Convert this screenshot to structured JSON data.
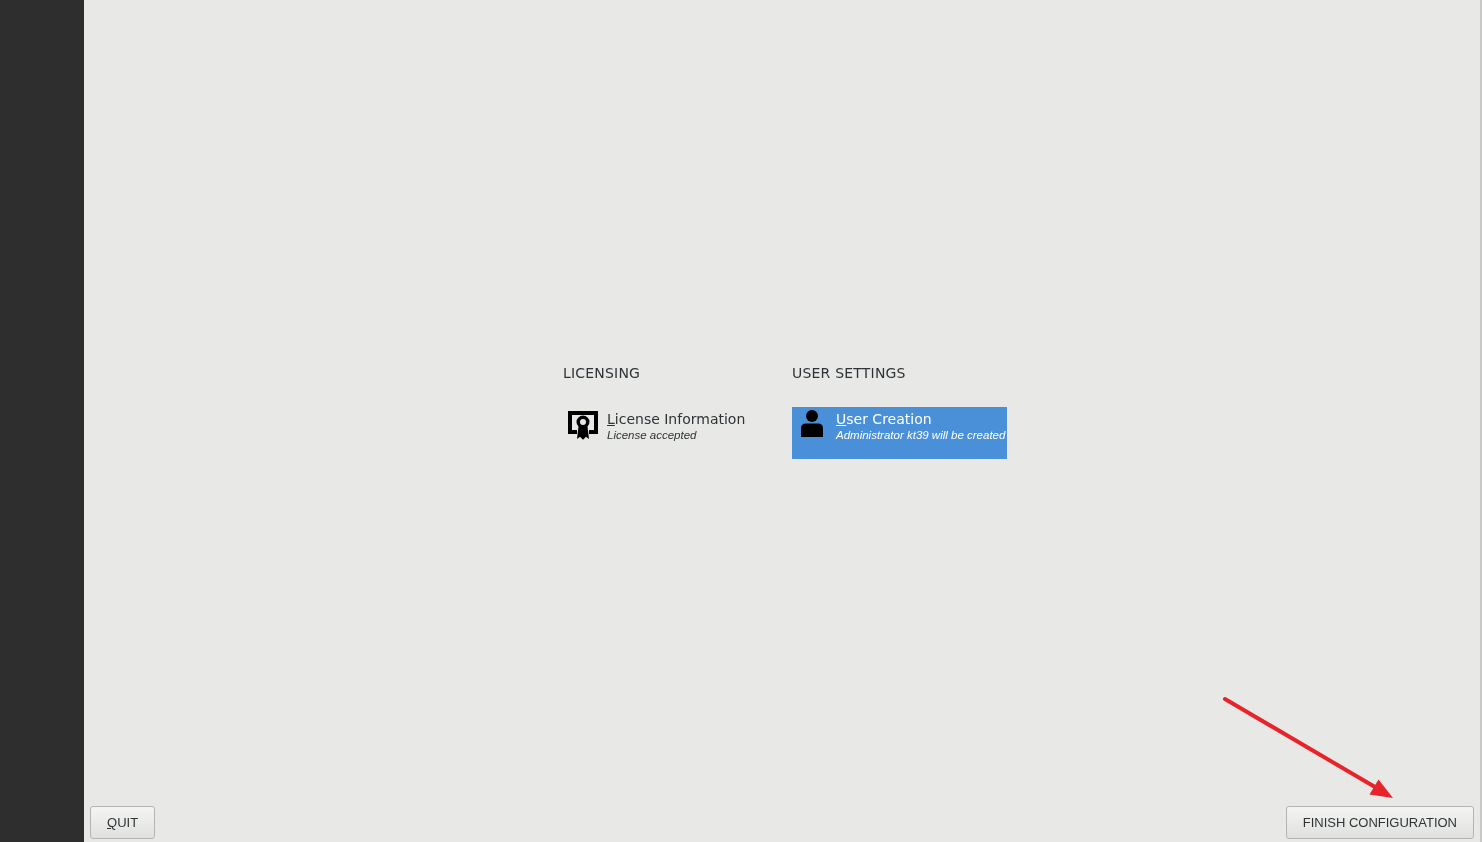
{
  "hub": {
    "categories": [
      {
        "title": "LICENSING",
        "spokes": [
          {
            "kind": "license",
            "title": "License Information",
            "status": "License accepted",
            "selected": false,
            "underline_first": true
          }
        ]
      },
      {
        "title": "USER SETTINGS",
        "spokes": [
          {
            "kind": "user",
            "title": "User Creation",
            "status": "Administrator kt39 will be created",
            "selected": true,
            "underline_first": true
          }
        ]
      }
    ]
  },
  "quit_button": {
    "label": "QUIT",
    "underline_first": true
  },
  "finish_button": {
    "label": "FINISH CONFIGURATION",
    "underline_first": false
  }
}
